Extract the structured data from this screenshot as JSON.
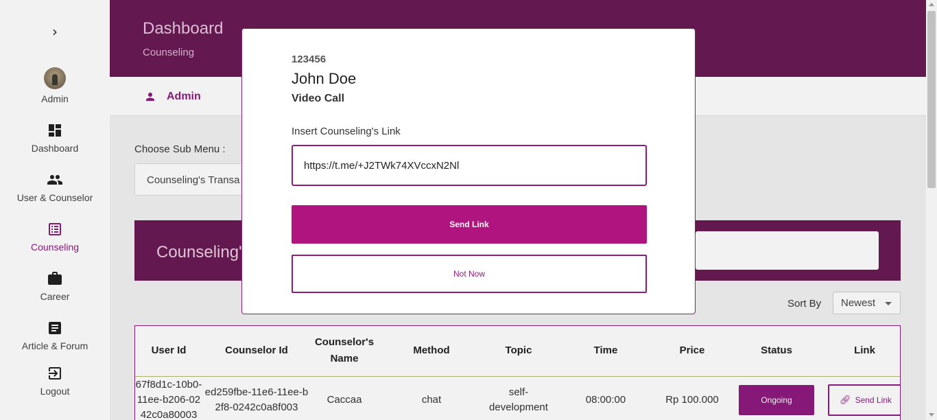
{
  "sidebar": {
    "toggle_icon": "chevron-right-icon",
    "items": [
      {
        "label": "Admin",
        "icon": "avatar"
      },
      {
        "label": "Dashboard",
        "icon": "dashboard-icon"
      },
      {
        "label": "User & Counselor",
        "icon": "people-icon"
      },
      {
        "label": "Counseling",
        "icon": "list-icon"
      },
      {
        "label": "Career",
        "icon": "briefcase-icon"
      },
      {
        "label": "Article & Forum",
        "icon": "article-icon"
      },
      {
        "label": "Logout",
        "icon": "logout-icon"
      }
    ]
  },
  "header": {
    "title": "Dashboard",
    "subtitle": "Counseling"
  },
  "adminbar": {
    "label": "Admin"
  },
  "submenu": {
    "label": "Choose Sub Menu :",
    "value": "Counseling's Transa"
  },
  "banner": {
    "title": "Counseling'"
  },
  "sort": {
    "label": "Sort By",
    "value": "Newest"
  },
  "table": {
    "headers": [
      "User Id",
      "Counselor Id",
      "Counselor's Name",
      "Method",
      "Topic",
      "Time",
      "Price",
      "Status",
      "Link"
    ],
    "rows": [
      {
        "user_id": "67f8d1c-10b0-11ee-b206-0242c0a80003",
        "counselor_id": "ed259fbe-11e6-11ee-b2f8-0242c0a8f003",
        "name": "Caccaa",
        "method": "chat",
        "topic": "self-development",
        "time": "08:00:00",
        "price": "Rp 100.000",
        "status": "Ongoing",
        "link": "Send Link"
      }
    ]
  },
  "modal": {
    "id": "123456",
    "name": "John Doe",
    "method": "Video Call",
    "input_label": "Insert Counseling's Link",
    "input_value": "https://t.me/+J2TWk74XVccxN2Nl",
    "send_label": "Send Link",
    "cancel_label": "Not Now"
  },
  "colors": {
    "accent": "#8e1b7f",
    "header": "#6a1a55",
    "button": "#b0157f"
  }
}
